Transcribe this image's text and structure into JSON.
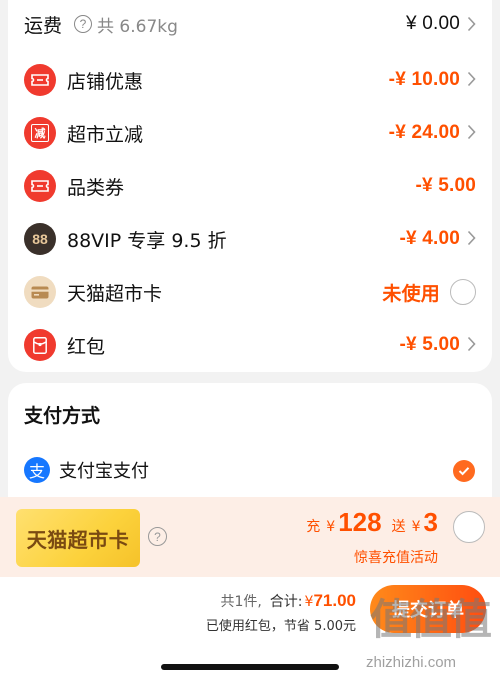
{
  "shipping": {
    "label": "运费",
    "weight": "共 6.67kg",
    "amount": "¥ 0.00"
  },
  "discounts": [
    {
      "icon": "coupon-icon",
      "label": "店铺优惠",
      "amount": "-¥ 10.00",
      "has_chevron": true
    },
    {
      "icon": "discount-stamp-icon",
      "icon_text": "减",
      "label": "超市立减",
      "amount": "-¥ 24.00",
      "has_chevron": true
    },
    {
      "icon": "coupon-icon",
      "label": "品类券",
      "amount": "-¥ 5.00",
      "has_chevron": false
    },
    {
      "icon": "88vip-icon",
      "icon_text": "88",
      "label": "88VIP 专享 9.5 折",
      "amount": "-¥ 4.00",
      "has_chevron": true
    },
    {
      "icon": "card-icon",
      "label": "天猫超市卡",
      "amount": "未使用",
      "has_chevron": false
    },
    {
      "icon": "red-packet-icon",
      "label": "红包",
      "amount": "-¥ 5.00",
      "has_chevron": true
    }
  ],
  "payment": {
    "title": "支付方式",
    "method_icon_text": "支",
    "method": "支付宝支付",
    "selected": true
  },
  "promo": {
    "card_label": "天猫超市卡",
    "recharge_prefix": "充",
    "recharge_currency": "¥",
    "recharge_amount": "128",
    "bonus_prefix": "送",
    "bonus_currency": "¥",
    "bonus_amount": "3",
    "subtitle": "惊喜充值活动"
  },
  "footer": {
    "count": "共1件,",
    "total_label": "合计:",
    "total_currency": "¥",
    "total_amount": "71.00",
    "saved_text": "已使用红包，节省 5.00元",
    "submit_label": "提交订单"
  },
  "watermark": {
    "text": "值值值",
    "url": "zhizhizhi.com"
  },
  "colors": {
    "accent": "#ff5000",
    "icon_red": "#f03a2e",
    "alipay_blue": "#1677ff",
    "promo_bg": "#fdeee6"
  }
}
